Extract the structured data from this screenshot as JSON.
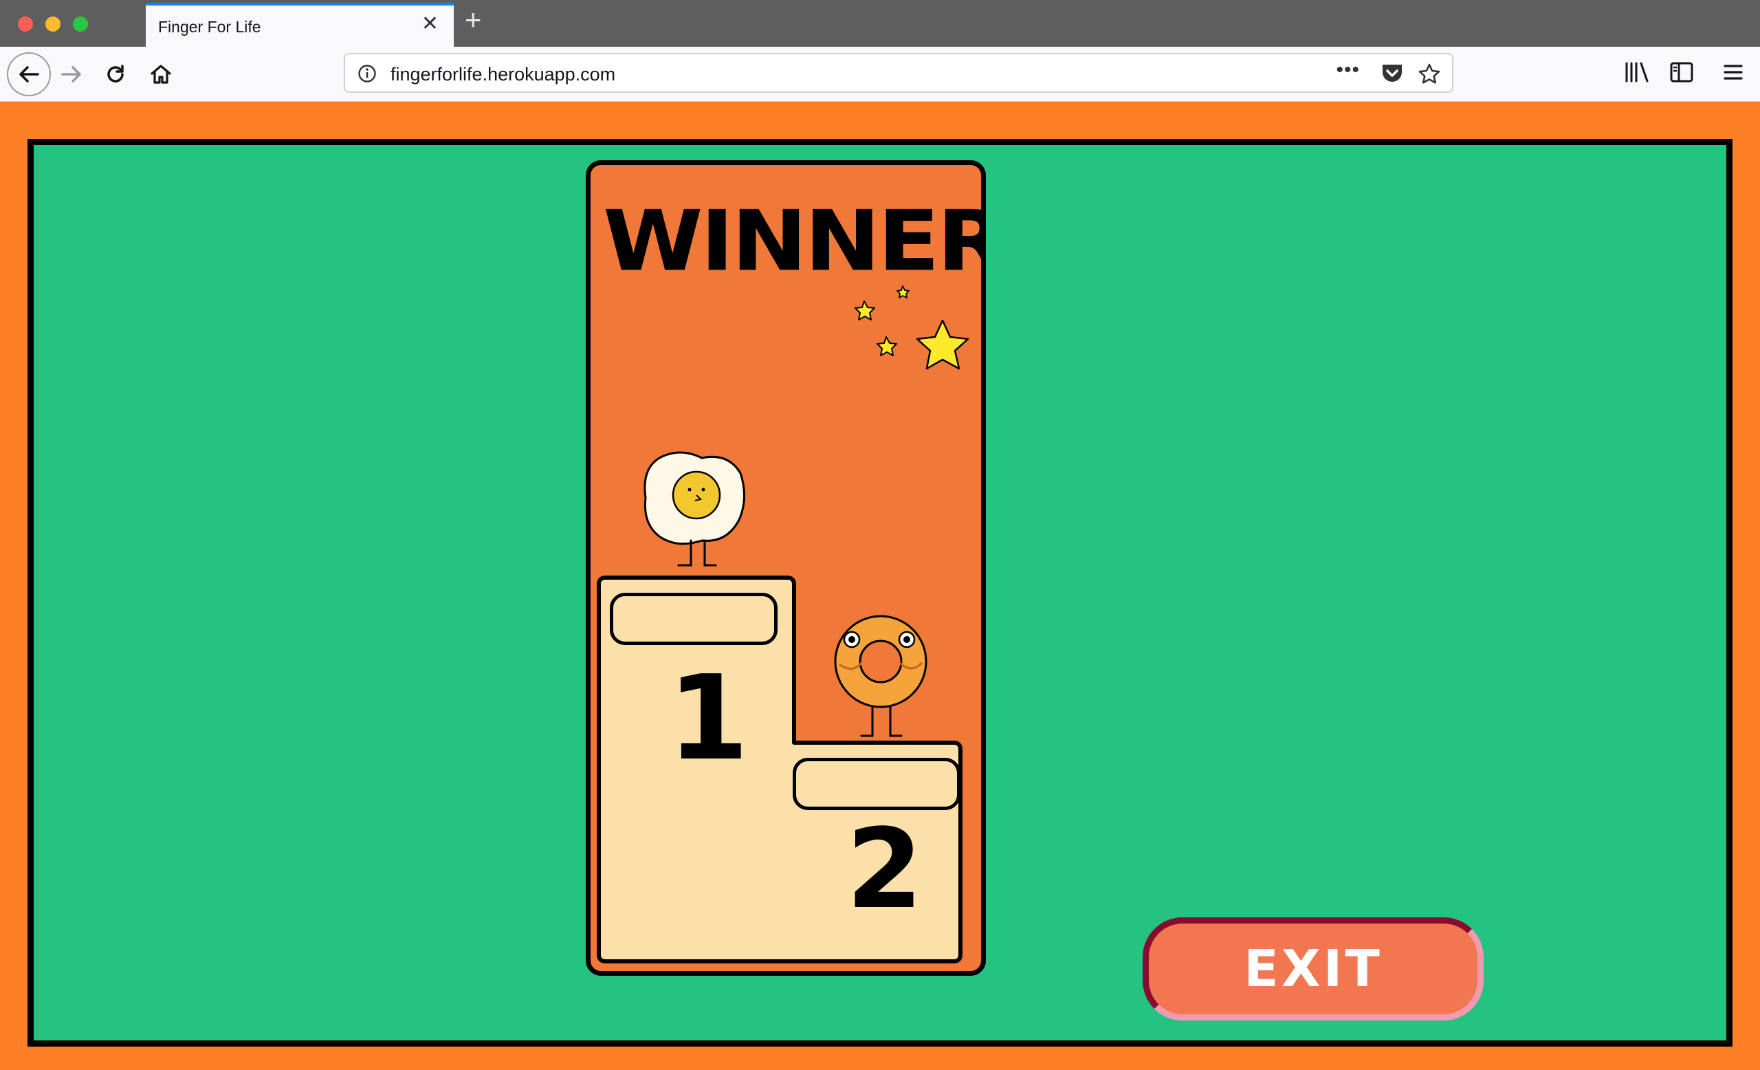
{
  "browser": {
    "tab_title": "Finger For Life",
    "url": "fingerforlife.herokuapp.com"
  },
  "game": {
    "title": "WINNER",
    "podium": [
      {
        "place": "1",
        "player": "egg"
      },
      {
        "place": "2",
        "player": "donut"
      }
    ],
    "exit_label": "EXIT"
  },
  "colors": {
    "page_background": "#FF7F27",
    "game_background": "#25C381",
    "panel": "#F07838",
    "podium": "#FBE0AA",
    "exit_button": "#F2764F"
  }
}
